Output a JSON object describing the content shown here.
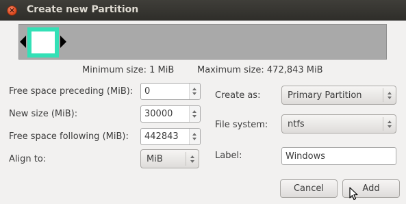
{
  "window": {
    "title": "Create new Partition",
    "close_glyph": "×"
  },
  "graphic": {
    "used_color": "#33e0b6",
    "free_color": "#a9a9a9",
    "used_fraction": 0.063
  },
  "size_info": {
    "minimum": "Minimum size: 1 MiB",
    "maximum": "Maximum size: 472,843 MiB"
  },
  "fields": {
    "free_preceding": {
      "label": "Free space preceding (MiB):",
      "value": "0"
    },
    "new_size": {
      "label": "New size (MiB):",
      "value": "30000"
    },
    "free_following": {
      "label": "Free space following (MiB):",
      "value": "442843"
    },
    "align_to": {
      "label": "Align to:",
      "value": "MiB"
    }
  },
  "options": {
    "create_as": {
      "label": "Create as:",
      "value": "Primary Partition"
    },
    "file_system": {
      "label": "File system:",
      "value": "ntfs"
    },
    "partition_label": {
      "label": "Label:",
      "value": "Windows"
    }
  },
  "buttons": {
    "cancel": "Cancel",
    "add": "Add"
  },
  "icons": {
    "close": "close-icon",
    "spin_up": "chevron-up-icon",
    "spin_down": "chevron-down-icon",
    "cursor": "mouse-pointer-icon"
  }
}
